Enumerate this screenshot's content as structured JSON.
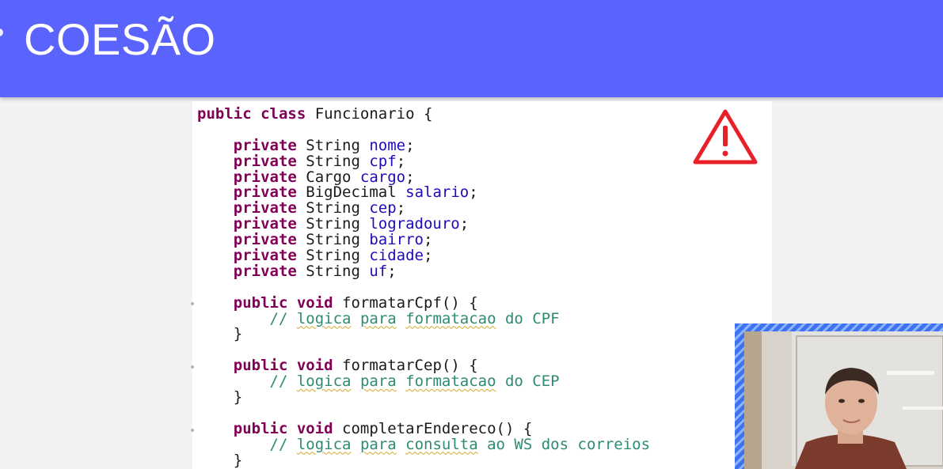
{
  "slide": {
    "title": "COESÃO"
  },
  "code": {
    "lines": [
      [
        {
          "t": "public class",
          "c": "kw"
        },
        {
          "t": " Funcionario {"
        }
      ],
      [],
      [
        {
          "t": "    "
        },
        {
          "t": "private",
          "c": "kw"
        },
        {
          "t": " String "
        },
        {
          "t": "nome",
          "c": "fld"
        },
        {
          "t": ";"
        }
      ],
      [
        {
          "t": "    "
        },
        {
          "t": "private",
          "c": "kw"
        },
        {
          "t": " String "
        },
        {
          "t": "cpf",
          "c": "fld"
        },
        {
          "t": ";"
        }
      ],
      [
        {
          "t": "    "
        },
        {
          "t": "private",
          "c": "kw"
        },
        {
          "t": " Cargo "
        },
        {
          "t": "cargo",
          "c": "fld"
        },
        {
          "t": ";"
        }
      ],
      [
        {
          "t": "    "
        },
        {
          "t": "private",
          "c": "kw"
        },
        {
          "t": " BigDecimal "
        },
        {
          "t": "salario",
          "c": "fld"
        },
        {
          "t": ";"
        }
      ],
      [
        {
          "t": "    "
        },
        {
          "t": "private",
          "c": "kw"
        },
        {
          "t": " String "
        },
        {
          "t": "cep",
          "c": "fld"
        },
        {
          "t": ";"
        }
      ],
      [
        {
          "t": "    "
        },
        {
          "t": "private",
          "c": "kw"
        },
        {
          "t": " String "
        },
        {
          "t": "logradouro",
          "c": "fld"
        },
        {
          "t": ";"
        }
      ],
      [
        {
          "t": "    "
        },
        {
          "t": "private",
          "c": "kw"
        },
        {
          "t": " String "
        },
        {
          "t": "bairro",
          "c": "fld"
        },
        {
          "t": ";"
        }
      ],
      [
        {
          "t": "    "
        },
        {
          "t": "private",
          "c": "kw"
        },
        {
          "t": " String "
        },
        {
          "t": "cidade",
          "c": "fld"
        },
        {
          "t": ";"
        }
      ],
      [
        {
          "t": "    "
        },
        {
          "t": "private",
          "c": "kw"
        },
        {
          "t": " String "
        },
        {
          "t": "uf",
          "c": "fld"
        },
        {
          "t": ";"
        }
      ],
      [],
      [
        {
          "t": "    "
        },
        {
          "t": "public void",
          "c": "kw"
        },
        {
          "t": " formatarCpf() {"
        }
      ],
      [
        {
          "t": "        "
        },
        {
          "t": "// ",
          "c": "cmt"
        },
        {
          "t": "logica",
          "c": "cmt typo"
        },
        {
          "t": " ",
          "c": "cmt"
        },
        {
          "t": "para",
          "c": "cmt typo"
        },
        {
          "t": " ",
          "c": "cmt"
        },
        {
          "t": "formatacao",
          "c": "cmt typo"
        },
        {
          "t": " do CPF",
          "c": "cmt"
        }
      ],
      [
        {
          "t": "    }"
        }
      ],
      [],
      [
        {
          "t": "    "
        },
        {
          "t": "public void",
          "c": "kw"
        },
        {
          "t": " formatarCep() {"
        }
      ],
      [
        {
          "t": "        "
        },
        {
          "t": "// ",
          "c": "cmt"
        },
        {
          "t": "logica",
          "c": "cmt typo"
        },
        {
          "t": " ",
          "c": "cmt"
        },
        {
          "t": "para",
          "c": "cmt typo"
        },
        {
          "t": " ",
          "c": "cmt"
        },
        {
          "t": "formatacao",
          "c": "cmt typo"
        },
        {
          "t": " do CEP",
          "c": "cmt"
        }
      ],
      [
        {
          "t": "    }"
        }
      ],
      [],
      [
        {
          "t": "    "
        },
        {
          "t": "public void",
          "c": "kw"
        },
        {
          "t": " completarEndereco() {"
        }
      ],
      [
        {
          "t": "        "
        },
        {
          "t": "// ",
          "c": "cmt"
        },
        {
          "t": "logica",
          "c": "cmt typo"
        },
        {
          "t": " ",
          "c": "cmt"
        },
        {
          "t": "para",
          "c": "cmt typo"
        },
        {
          "t": " ",
          "c": "cmt"
        },
        {
          "t": "consulta",
          "c": "cmt typo"
        },
        {
          "t": " ao WS dos correios",
          "c": "cmt"
        }
      ],
      [
        {
          "t": "    }"
        }
      ]
    ]
  },
  "icons": {
    "warning": "warning-triangle-icon"
  },
  "colors": {
    "header": "#5a63fb",
    "keyword": "#7f0055",
    "field": "#1f0ab8",
    "comment": "#2e8a72",
    "warning": "#e8202a",
    "webcam_border": "#3d73f0"
  }
}
